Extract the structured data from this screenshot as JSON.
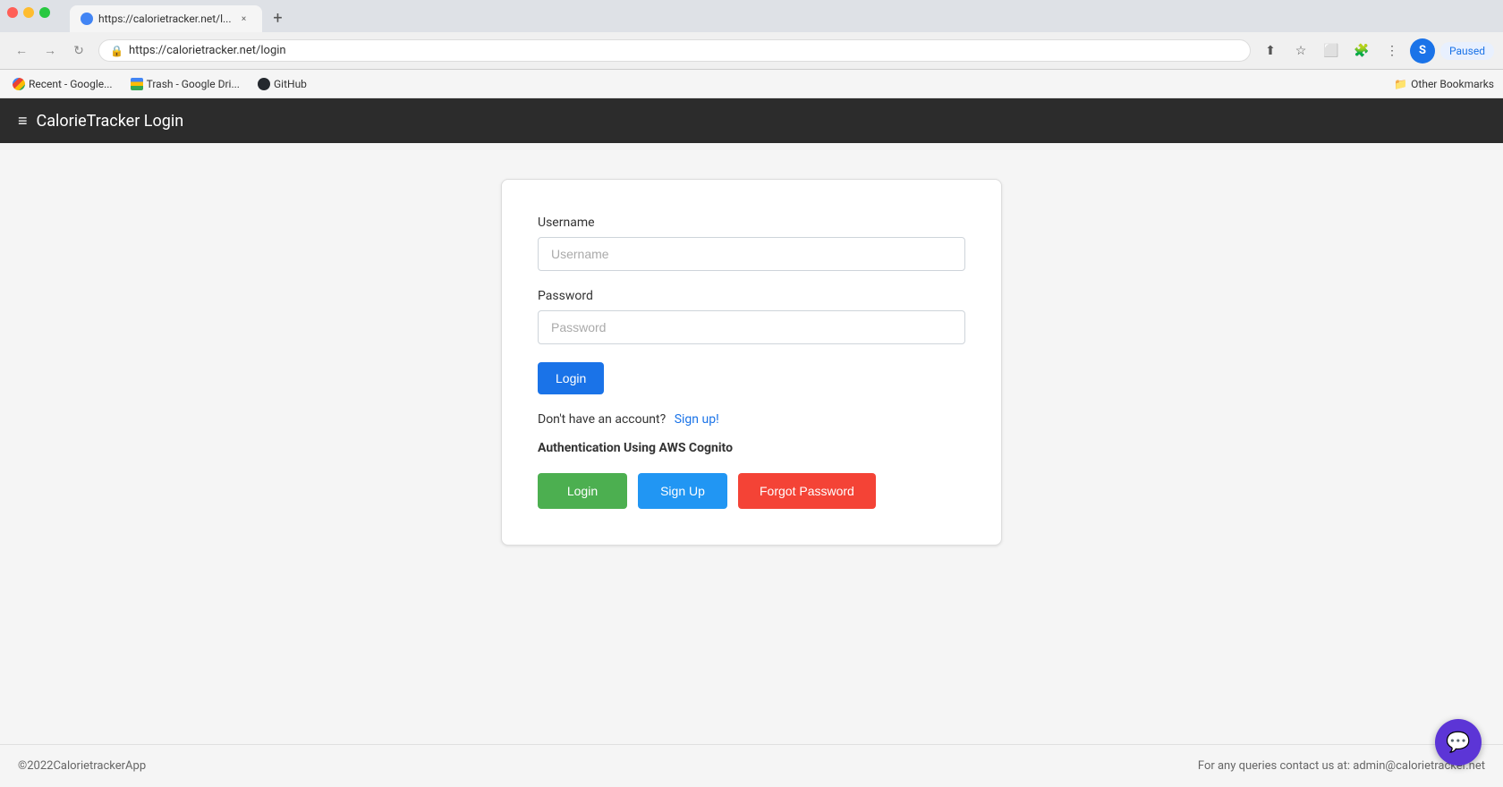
{
  "browser": {
    "tab": {
      "favicon_color": "#4285f4",
      "title": "https://calorietracker.net/l...",
      "close_label": "×"
    },
    "new_tab_label": "+",
    "address": "https://calorietracker.net/login",
    "traffic_lights": [
      "red",
      "yellow",
      "green"
    ],
    "paused_label": "Paused",
    "profile_initial": "S",
    "bookmarks": [
      {
        "label": "Recent - Google...",
        "type": "google"
      },
      {
        "label": "Trash - Google Dri...",
        "type": "drive"
      },
      {
        "label": "GitHub",
        "type": "github"
      }
    ],
    "other_bookmarks_label": "Other Bookmarks"
  },
  "app": {
    "header": {
      "icon": "≡",
      "title": "CalorieTracker Login"
    },
    "login_card": {
      "username_label": "Username",
      "username_placeholder": "Username",
      "password_label": "Password",
      "password_placeholder": "Password",
      "login_button_label": "Login",
      "signup_prompt": "Don't have an account?",
      "signup_link_label": "Sign up!",
      "auth_section_title": "Authentication Using AWS Cognito",
      "auth_buttons": [
        {
          "label": "Login",
          "type": "login"
        },
        {
          "label": "Sign Up",
          "type": "signup"
        },
        {
          "label": "Forgot Password",
          "type": "forgot"
        }
      ]
    },
    "footer": {
      "copyright": "©2022CalorietrackerApp",
      "contact": "For any queries contact us at: admin@calorietracker.net"
    },
    "chat_icon": "💬"
  }
}
